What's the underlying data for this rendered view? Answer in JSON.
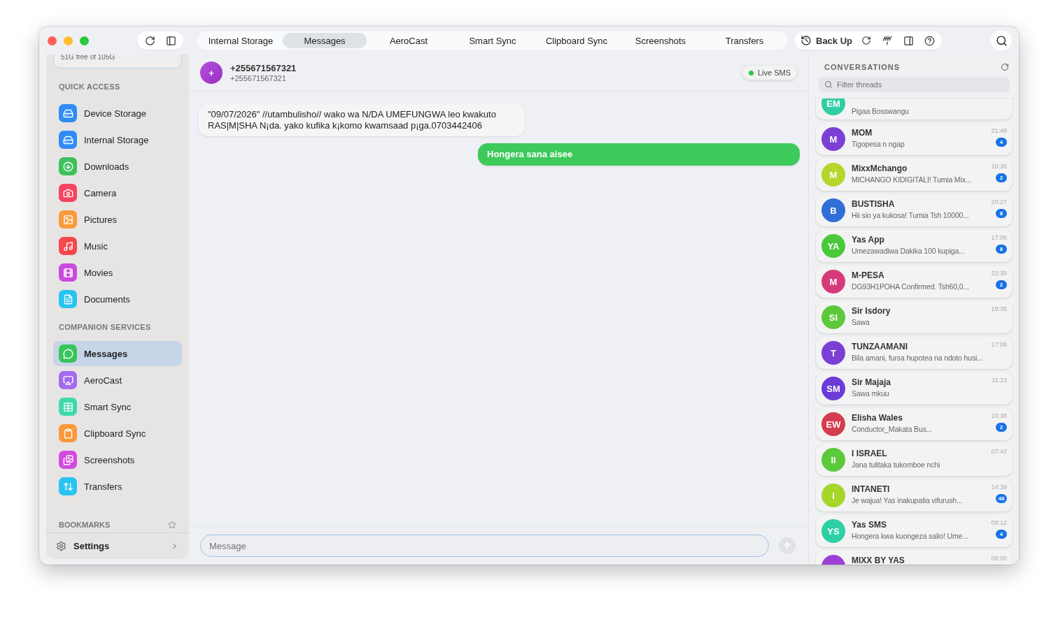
{
  "toolbar": {
    "tabs": [
      {
        "label": "Internal Storage",
        "selected": false
      },
      {
        "label": "Messages",
        "selected": true
      },
      {
        "label": "AeroCast",
        "selected": false
      },
      {
        "label": "Smart Sync",
        "selected": false
      },
      {
        "label": "Clipboard Sync",
        "selected": false
      },
      {
        "label": "Screenshots",
        "selected": false
      },
      {
        "label": "Transfers",
        "selected": false
      }
    ],
    "backup_label": "Back Up"
  },
  "sidebar": {
    "storage_text": "51G free of 105G",
    "sections": [
      {
        "title": "QUICK ACCESS",
        "items": [
          {
            "label": "Device Storage",
            "color": "#2f8cf5",
            "selected": false
          },
          {
            "label": "Internal Storage",
            "color": "#2f8cf5",
            "selected": false
          },
          {
            "label": "Downloads",
            "color": "#3ec15b",
            "selected": false
          },
          {
            "label": "Camera",
            "color": "#f6435f",
            "selected": false
          },
          {
            "label": "Pictures",
            "color": "#fb9a3c",
            "selected": false
          },
          {
            "label": "Music",
            "color": "#f5484c",
            "selected": false
          },
          {
            "label": "Movies",
            "color": "#c94ae0",
            "selected": false
          },
          {
            "label": "Documents",
            "color": "#27c4ef",
            "selected": false
          }
        ]
      },
      {
        "title": "COMPANION SERVICES",
        "items": [
          {
            "label": "Messages",
            "color": "#38c558",
            "selected": true
          },
          {
            "label": "AeroCast",
            "color": "#a36cf0",
            "selected": false
          },
          {
            "label": "Smart Sync",
            "color": "#3fd9ac",
            "selected": false
          },
          {
            "label": "Clipboard Sync",
            "color": "#fb983c",
            "selected": false
          },
          {
            "label": "Screenshots",
            "color": "#d44be0",
            "selected": false
          },
          {
            "label": "Transfers",
            "color": "#27c4ef",
            "selected": false
          }
        ]
      }
    ],
    "bookmarks_title": "BOOKMARKS",
    "settings_label": "Settings"
  },
  "chat": {
    "avatar": "+",
    "title": "+255671567321",
    "subtitle": "+255671567321",
    "live_label": "Live SMS",
    "messages": [
      {
        "kind": "incoming",
        "text": "\"09/07/2026\" //utambulisho// wako wa N/DA UMEFUNGWA leo kwakuto RAS|M|SHA N¡da. yako kufika k¡komo kwamsaad p¡ga.0703442406"
      },
      {
        "kind": "outgoing",
        "text": "Hongera sana aisee"
      }
    ],
    "composer": {
      "placeholder": "Message"
    }
  },
  "conversations": {
    "title": "CONVERSATIONS",
    "filter": {
      "placeholder": "Filter threads"
    },
    "threads": [
      {
        "initials": "EM",
        "preview": "Pigaa Bosswangu",
        "color": "#2ecfa4"
      },
      {
        "initials": "M",
        "name": "MOM",
        "time": "21:48",
        "preview": "Tigopesa n ngap",
        "unread": "4",
        "color": "#7b3fd6"
      },
      {
        "initials": "M",
        "name": "MixxMchango",
        "time": "10:36",
        "preview": "MICHANGO KIDIGITALI! Tumia Mix...",
        "unread": "2",
        "color": "#b5d62a"
      },
      {
        "initials": "B",
        "name": "BUSTISHA",
        "time": "20:27",
        "preview": "Hii sio ya kukosa! Tumia Tsh 10000...",
        "unread": "8",
        "color": "#2f6fd6"
      },
      {
        "initials": "YA",
        "name": "Yas App",
        "time": "17:06",
        "preview": "Umezawadiwa Dakika 100 kupiga...",
        "unread": "8",
        "color": "#4cc93a"
      },
      {
        "initials": "M",
        "name": "M-PESA",
        "time": "22:30",
        "preview": "DG93H1POHA Confirmed. Tsh60,0...",
        "unread": "2",
        "color": "#d63a7a"
      },
      {
        "initials": "SI",
        "name": "Sir Isdory",
        "time": "19:35",
        "preview": "Sawa",
        "color": "#5cc93a"
      },
      {
        "initials": "T",
        "name": "TUNZAAMANI",
        "time": "17:08",
        "preview": "Bila amani, fursa hupotea na ndoto husi...",
        "color": "#7b3fd6"
      },
      {
        "initials": "SM",
        "name": "Sir Majaja",
        "time": "11:23",
        "preview": "Sawa mkuu",
        "color": "#6a3bd6"
      },
      {
        "initials": "EW",
        "name": "Elisha Wales",
        "time": "10:38",
        "preview": "Conductor_Makata Bus...",
        "unread": "2",
        "color": "#d43d4f"
      },
      {
        "initials": "II",
        "name": "I ISRAEL",
        "time": "07:42",
        "preview": "Jana tulitaka tukomboe nchi",
        "color": "#5cc93a"
      },
      {
        "initials": "I",
        "name": "INTANETI",
        "time": "14:39",
        "preview": "Je wajua!  Yas inakupatia vifurush...",
        "unread": "48",
        "color": "#a6d62a"
      },
      {
        "initials": "YS",
        "name": "Yas SMS",
        "time": "08:12",
        "preview": "Hongera kwa kuongeza salio! Ume...",
        "unread": "4",
        "color": "#2ecfa4"
      },
      {
        "name": "MIXX BY YAS",
        "time": "08:00",
        "color": "#9b3fd6"
      }
    ]
  }
}
